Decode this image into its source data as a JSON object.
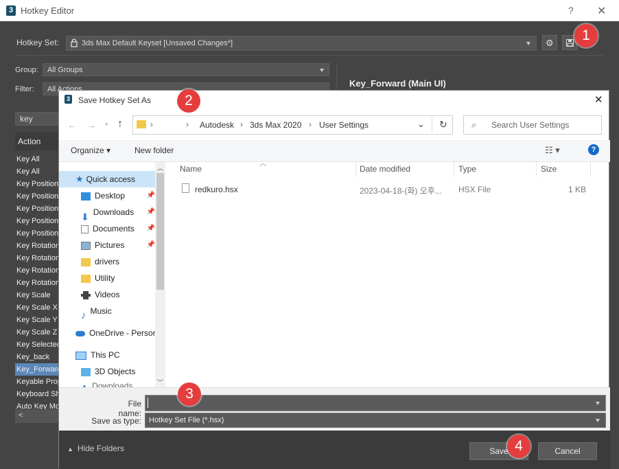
{
  "window": {
    "title": "Hotkey Editor",
    "help": "?",
    "close": "✕",
    "app_glyph": "3"
  },
  "hotkey_set": {
    "label": "Hotkey Set:",
    "value": "3ds Max Default Keyset [Unsaved Changes*]"
  },
  "group": {
    "label": "Group:",
    "value": "All Groups"
  },
  "filter": {
    "label": "Filter:",
    "value": "All Actions"
  },
  "search_value": "key",
  "action_column": "Action",
  "actions": [
    "Key All",
    "Key All",
    "Key Position",
    "Key Position",
    "Key Position",
    "Key Position",
    "Key Position,",
    "Key Rotation",
    "Key Rotation",
    "Key Rotation",
    "Key Rotation",
    "Key Scale",
    "Key Scale X",
    "Key Scale Y",
    "Key Scale Z",
    "Key Selected",
    "Key_back",
    "Key_Forward",
    "Keyable Prop",
    "Keyboard Sh",
    "Auto Key Mo"
  ],
  "selected_action_index": 17,
  "detail_title": "Key_Forward (Main UI)",
  "dialog": {
    "title": "Save Hotkey Set As",
    "close": "✕",
    "breadcrumb": [
      "Autodesk",
      "3ds Max 2020",
      "User Settings"
    ],
    "search_placeholder": "Search User Settings",
    "organize": "Organize ▾",
    "new_folder": "New folder",
    "nav": {
      "quick_access": "Quick access",
      "pinned": [
        "Desktop",
        "Downloads",
        "Documents",
        "Pictures"
      ],
      "folders": [
        "drivers",
        "Utility",
        "Videos",
        "Music"
      ],
      "onedrive": "OneDrive - Person",
      "this_pc": "This PC",
      "objects3d": "3D Objects",
      "downloads_partial": "Downloads"
    },
    "columns": {
      "name": "Name",
      "date": "Date modified",
      "type": "Type",
      "size": "Size"
    },
    "files": [
      {
        "name": "redkuro.hsx",
        "date": "2023-04-18-(화) 오후...",
        "type": "HSX File",
        "size": "1 KB"
      }
    ],
    "file_name_label": "File name:",
    "file_name_value": "",
    "save_type_label": "Save as type:",
    "save_type_value": "Hotkey Set File (*.hsx)",
    "hide_folders": "Hide Folders",
    "save": "Save",
    "cancel": "Cancel"
  },
  "callouts": [
    "1",
    "2",
    "3",
    "4"
  ],
  "colors": {
    "callout": "#e53d3d",
    "accent": "#0a66c2",
    "dark_bg": "#444444",
    "selected": "#5b87b8"
  }
}
